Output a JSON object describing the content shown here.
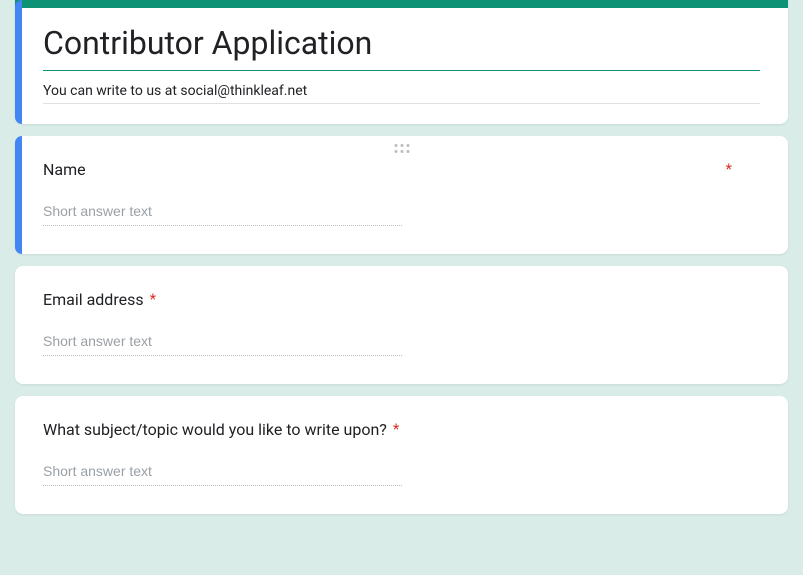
{
  "header": {
    "title": "Contributor Application",
    "description": "You can write to us at social@thinkleaf.net"
  },
  "questions": [
    {
      "label": "Name",
      "required": true,
      "placeholder": "Short answer text",
      "selected": true
    },
    {
      "label": "Email address",
      "required": true,
      "placeholder": "Short answer text",
      "selected": false
    },
    {
      "label": "What subject/topic would you like to write upon?",
      "required": true,
      "placeholder": "Short answer text",
      "selected": false
    }
  ],
  "colors": {
    "theme": "#0d9276",
    "accent": "#4285f4",
    "required": "#d93025"
  }
}
